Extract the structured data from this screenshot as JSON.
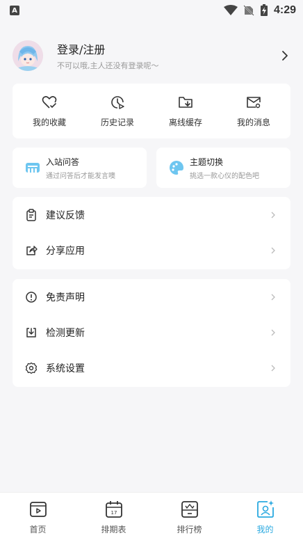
{
  "status_bar": {
    "time": "4:29",
    "app_badge": "A"
  },
  "profile": {
    "title": "登录/注册",
    "subtitle": "不可以哦,主人还没有登录呢～"
  },
  "quick_actions": [
    {
      "label": "我的收藏",
      "icon": "heart-check-icon"
    },
    {
      "label": "历史记录",
      "icon": "clock-play-icon"
    },
    {
      "label": "离线缓存",
      "icon": "folder-download-icon"
    },
    {
      "label": "我的消息",
      "icon": "mail-at-icon"
    }
  ],
  "features": [
    {
      "title": "入站问答",
      "subtitle": "通过问答后才能发言噢",
      "icon": "quiz-icon"
    },
    {
      "title": "主题切换",
      "subtitle": "挑选一款心仪的配色吧",
      "icon": "palette-icon"
    }
  ],
  "menu_group_1": [
    {
      "label": "建议反馈",
      "icon": "clipboard-icon"
    },
    {
      "label": "分享应用",
      "icon": "share-icon"
    }
  ],
  "menu_group_2": [
    {
      "label": "免责声明",
      "icon": "info-circle-icon"
    },
    {
      "label": "检测更新",
      "icon": "update-download-icon"
    },
    {
      "label": "系统设置",
      "icon": "gear-icon"
    }
  ],
  "tabbar": [
    {
      "label": "首页",
      "icon": "home-play-icon",
      "active": false
    },
    {
      "label": "排期表",
      "icon": "calendar-icon",
      "active": false
    },
    {
      "label": "排行榜",
      "icon": "ranking-icon",
      "active": false
    },
    {
      "label": "我的",
      "icon": "profile-icon",
      "active": true
    }
  ],
  "colors": {
    "accent": "#2aa9e0",
    "background": "#f6f6f8",
    "card": "#ffffff"
  }
}
